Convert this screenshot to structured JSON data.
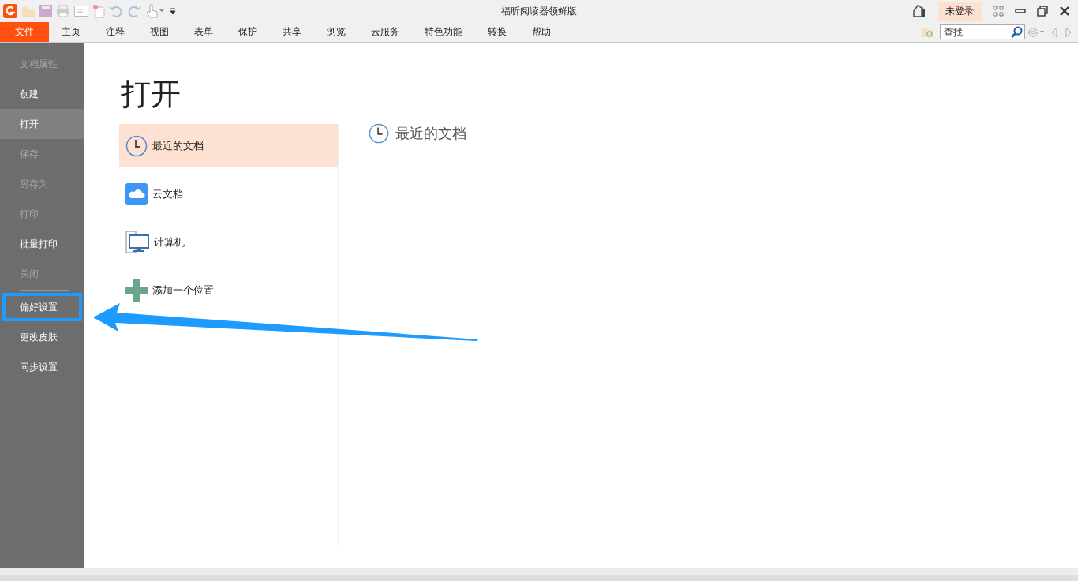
{
  "window": {
    "title": "福昕阅读器领鲜版"
  },
  "account": {
    "label": "未登录"
  },
  "menu_tabs": [
    {
      "label": "文件",
      "selected": true
    },
    {
      "label": "主页",
      "selected": false
    },
    {
      "label": "注释",
      "selected": false
    },
    {
      "label": "视图",
      "selected": false
    },
    {
      "label": "表单",
      "selected": false
    },
    {
      "label": "保护",
      "selected": false
    },
    {
      "label": "共享",
      "selected": false
    },
    {
      "label": "浏览",
      "selected": false
    },
    {
      "label": "云服务",
      "selected": false
    },
    {
      "label": "特色功能",
      "selected": false
    },
    {
      "label": "转换",
      "selected": false
    },
    {
      "label": "帮助",
      "selected": false
    }
  ],
  "search": {
    "placeholder": "查找"
  },
  "sidebar": {
    "groups": [
      {
        "items": [
          {
            "label": "文档属性",
            "disabled": true,
            "selected": false,
            "highlighted": false
          },
          {
            "label": "创建",
            "disabled": false,
            "selected": false,
            "highlighted": false
          },
          {
            "label": "打开",
            "disabled": false,
            "selected": true,
            "highlighted": false
          },
          {
            "label": "保存",
            "disabled": true,
            "selected": false,
            "highlighted": false
          },
          {
            "label": "另存为",
            "disabled": true,
            "selected": false,
            "highlighted": false
          },
          {
            "label": "打印",
            "disabled": true,
            "selected": false,
            "highlighted": false
          },
          {
            "label": "批量打印",
            "disabled": false,
            "selected": false,
            "highlighted": false
          },
          {
            "label": "关闭",
            "disabled": true,
            "selected": false,
            "highlighted": false
          }
        ]
      },
      {
        "items": [
          {
            "label": "偏好设置",
            "disabled": false,
            "selected": false,
            "highlighted": true
          },
          {
            "label": "更改皮肤",
            "disabled": false,
            "selected": false,
            "highlighted": false
          },
          {
            "label": "同步设置",
            "disabled": false,
            "selected": false,
            "highlighted": false
          }
        ]
      }
    ]
  },
  "open_page": {
    "title": "打开",
    "locations": [
      {
        "label": "最近的文档",
        "kind": "recent",
        "selected": true
      },
      {
        "label": "云文档",
        "kind": "cloud",
        "selected": false
      },
      {
        "label": "计算机",
        "kind": "computer",
        "selected": false
      },
      {
        "label": "添加一个位置",
        "kind": "add",
        "selected": false
      }
    ],
    "detail": {
      "title": "最近的文档"
    }
  }
}
